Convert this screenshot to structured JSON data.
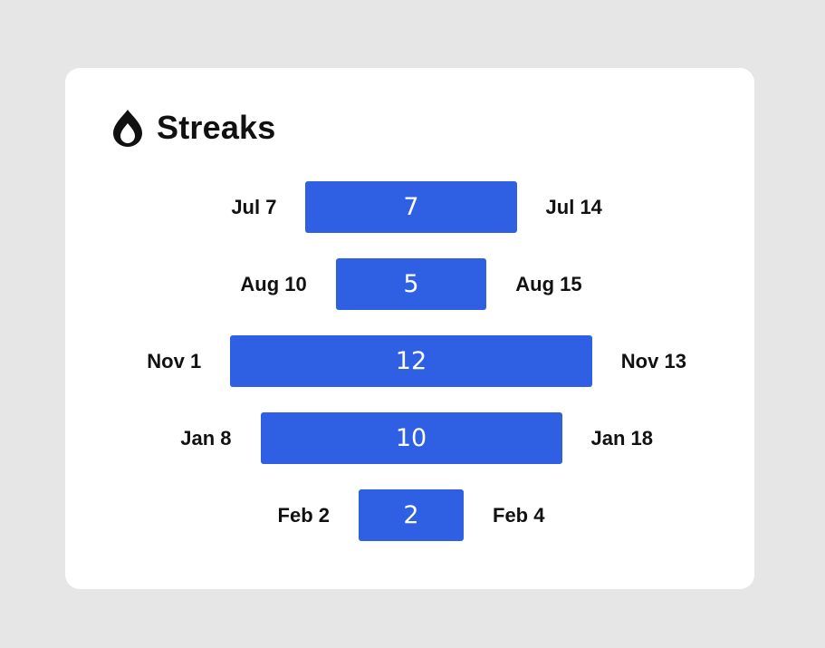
{
  "header": {
    "title": "Streaks",
    "icon": "flame-icon"
  },
  "colors": {
    "background": "#e6e6e6",
    "card": "#ffffff",
    "bar": "#2f5fe3",
    "text": "#111111"
  },
  "chart_data": {
    "type": "bar",
    "title": "Streaks",
    "bars": [
      {
        "start": "Jul 7",
        "end": "Jul 14",
        "value": 7
      },
      {
        "start": "Aug 10",
        "end": "Aug 15",
        "value": 5
      },
      {
        "start": "Nov 1",
        "end": "Nov 13",
        "value": 12
      },
      {
        "start": "Jan 8",
        "end": "Jan 18",
        "value": 10
      },
      {
        "start": "Feb 2",
        "end": "Feb 4",
        "value": 2
      }
    ]
  }
}
